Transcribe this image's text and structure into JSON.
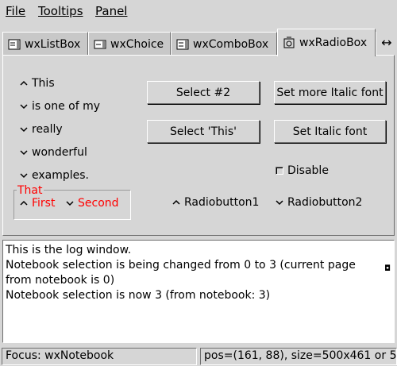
{
  "menubar": {
    "items": [
      {
        "label": "File"
      },
      {
        "label": "Tooltips"
      },
      {
        "label": "Panel"
      }
    ]
  },
  "notebook": {
    "tabs": [
      {
        "label": "wxListBox",
        "icon": "listbox-icon"
      },
      {
        "label": "wxChoice",
        "icon": "choice-icon"
      },
      {
        "label": "wxComboBox",
        "icon": "combobox-icon"
      },
      {
        "label": "wxRadioBox",
        "icon": "radiobox-icon",
        "active": true
      }
    ],
    "scroll_glyph": "↔"
  },
  "radiobox_main": {
    "options": [
      "This",
      "is one of my",
      "really",
      "wonderful",
      "examples."
    ],
    "selected_index": 0
  },
  "buttons": {
    "select2": "Select #2",
    "select_this": "Select 'This'",
    "more_italic": "Set more Italic font",
    "italic": "Set Italic font"
  },
  "checkbox": {
    "label": "Disable",
    "checked": false
  },
  "radiobox_that": {
    "title": "That",
    "options": [
      "First",
      "Second"
    ],
    "selected_index": 0,
    "color": "#ff0000"
  },
  "radiobuttons": {
    "rb1": "Radiobutton1",
    "rb2": "Radiobutton2",
    "selected": "rb1"
  },
  "log": {
    "lines": [
      "This is the log window.",
      "Notebook selection is being changed from 0 to 3 (current page from notebook is 0)",
      "Notebook selection is now 3 (from notebook: 3)"
    ]
  },
  "statusbar": {
    "focus": "Focus: wxNotebook",
    "pos": "pos=(161, 88), size=500x461 or 5"
  }
}
